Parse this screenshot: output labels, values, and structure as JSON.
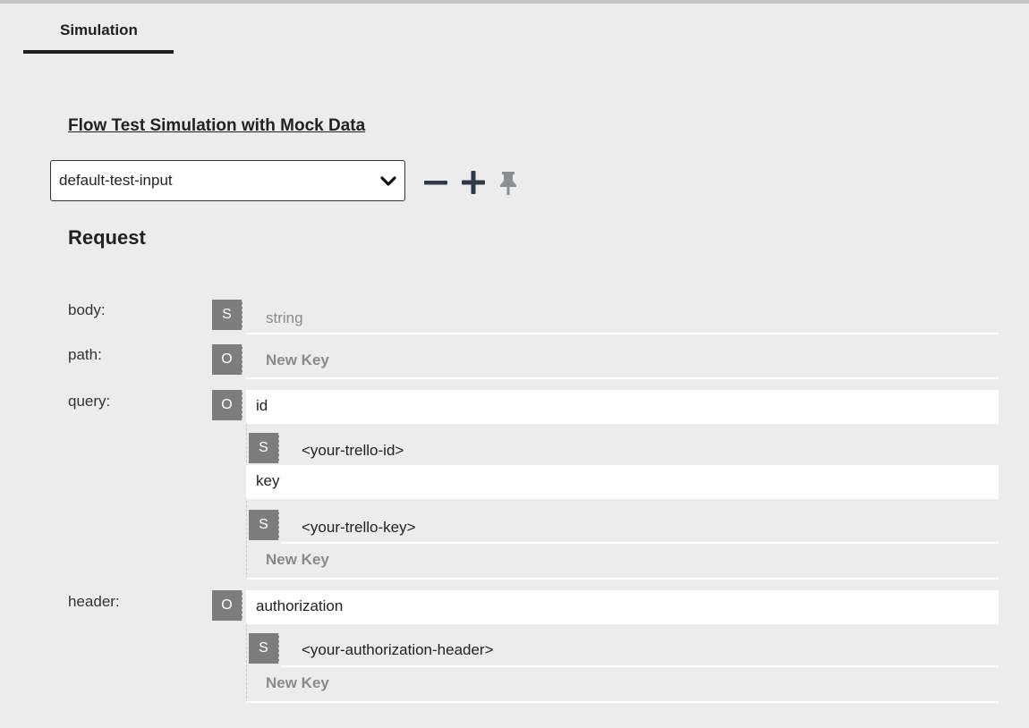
{
  "tabs": [
    {
      "label": "Simulation",
      "active": true
    }
  ],
  "simulation": {
    "title": "Flow Test Simulation with Mock Data",
    "selected_input": "default-test-input"
  },
  "icons": {
    "remove": "minus-icon",
    "add": "plus-icon",
    "pin": "pin-icon",
    "dropdown": "chevron-down-icon"
  },
  "request": {
    "heading": "Request",
    "fields": {
      "body": {
        "label": "body:",
        "type_badge": "S",
        "placeholder": "string"
      },
      "path": {
        "label": "path:",
        "type_badge": "O",
        "new_key": "New Key"
      },
      "query": {
        "label": "query:",
        "type_badge": "O",
        "entries": [
          {
            "key": "id",
            "type_badge": "S",
            "value": "<your-trello-id>"
          },
          {
            "key": "key",
            "type_badge": "S",
            "value": "<your-trello-key>"
          }
        ],
        "new_key": "New Key"
      },
      "header": {
        "label": "header:",
        "type_badge": "O",
        "entries": [
          {
            "key": "authorization",
            "type_badge": "S",
            "value": "<your-authorization-header>"
          }
        ],
        "new_key": "New Key"
      }
    }
  },
  "colors": {
    "background": "#ececed",
    "badge": "#7d7d7d",
    "tab_underline": "#1f1f1f",
    "icon_dark": "#2e3a46",
    "icon_muted": "#8a8f94"
  }
}
